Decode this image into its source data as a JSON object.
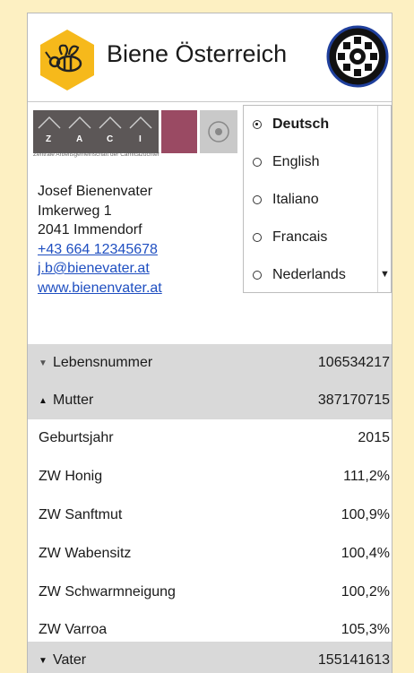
{
  "header": {
    "title": "Biene Österreich"
  },
  "contact": {
    "name": "Josef Bienenvater",
    "street": "Imkerweg 1",
    "city": "2041 Immendorf",
    "phone": "+43 664 12345678",
    "email": "j.b@bienevater.at",
    "website": "www.bienenvater.at"
  },
  "banner": {
    "letters": [
      "Z",
      "A",
      "C",
      "I"
    ],
    "caption": "Zentrale Arbeitsgemeinschaft der Carnicazüchter"
  },
  "languages": {
    "items": [
      "Deutsch",
      "English",
      "Italiano",
      "Francais",
      "Nederlands"
    ],
    "selected": "Deutsch"
  },
  "details": {
    "rows": [
      {
        "label": "Lebensnummer",
        "value": "106534217"
      },
      {
        "label": "Mutter",
        "value": "387170715"
      },
      {
        "label": "Geburtsjahr",
        "value": "2015"
      },
      {
        "label": "ZW Honig",
        "value": "111,2%"
      },
      {
        "label": "ZW Sanftmut",
        "value": "100,9%"
      },
      {
        "label": "ZW Wabensitz",
        "value": "100,4%"
      },
      {
        "label": "ZW Schwarmneigung",
        "value": "100,2%"
      },
      {
        "label": "ZW Varroa",
        "value": "105,3%"
      },
      {
        "label": "Vater",
        "value": "155141613"
      }
    ]
  },
  "colors": {
    "page_background": "#fdf0c2",
    "hex_logo": "#f6b91b",
    "link": "#1f4fc1",
    "row_highlight": "#d9d9d9"
  },
  "icons": [
    "bee-hex-logo-icon",
    "round-emblem-logo-icon",
    "radio-icon",
    "scroll-down-arrow-icon",
    "expand-arrow-icon",
    "collapse-arrow-icon"
  ]
}
